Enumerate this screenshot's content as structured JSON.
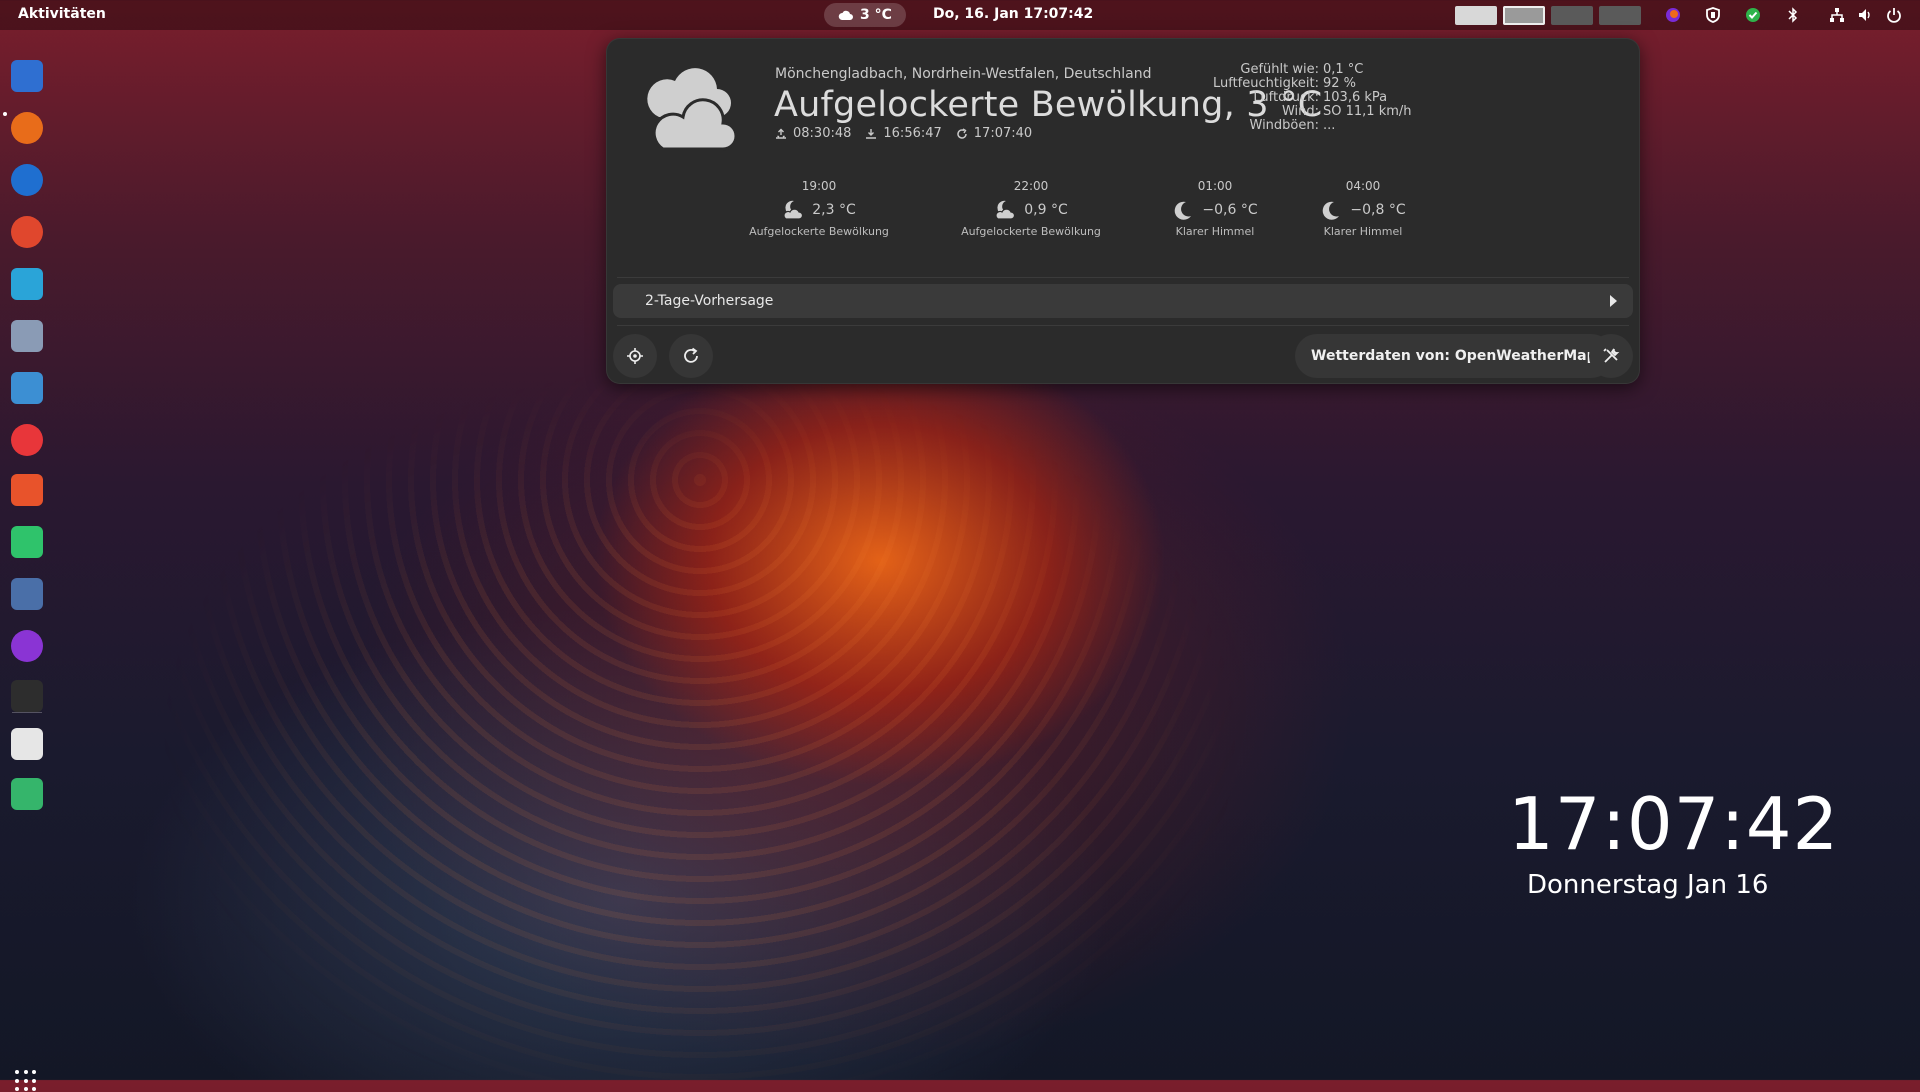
{
  "topbar": {
    "activities": "Aktivitäten",
    "weather_temp": "3 °C",
    "clock": "Do, 16. Jan  17:07:42",
    "workspaces": [
      {
        "name": "workspace-1",
        "color": "#d8d8d8"
      },
      {
        "name": "workspace-2",
        "color": "#9a9a9a"
      },
      {
        "name": "workspace-3",
        "color": "#5a5a5a"
      },
      {
        "name": "workspace-4",
        "color": "#5a5a5a"
      }
    ],
    "tray_icons": [
      "firefox-tray-icon",
      "shield-icon",
      "check-icon",
      "bluetooth-icon",
      "network-icon",
      "volume-icon",
      "power-icon"
    ]
  },
  "dock": {
    "items": [
      {
        "name": "text-editor-icon",
        "color": "#2f6fd1"
      },
      {
        "name": "firefox-icon",
        "color": "#e86c1a"
      },
      {
        "name": "thunderbird-icon",
        "color": "#1f6fd0"
      },
      {
        "name": "app-red-icon",
        "color": "#e0472d"
      },
      {
        "name": "screenshot-icon",
        "color": "#2aa4d8"
      },
      {
        "name": "software-icon",
        "color": "#8a9bb5"
      },
      {
        "name": "remote-desktop-icon",
        "color": "#3c8fd3"
      },
      {
        "name": "vivaldi-icon",
        "color": "#e8363a"
      },
      {
        "name": "downloader-icon",
        "color": "#e8532b"
      },
      {
        "name": "extensions-icon",
        "color": "#2fc36b"
      },
      {
        "name": "app-blue-icon",
        "color": "#4a6fa8"
      },
      {
        "name": "firefox-dev-icon",
        "color": "#8a34d4"
      },
      {
        "name": "terminal-icon",
        "color": "#2d2d2d"
      },
      {
        "name": "document-icon",
        "color": "#e6e6e6"
      },
      {
        "name": "trash-icon",
        "color": "#35b56b"
      }
    ]
  },
  "weather": {
    "location": "Mönchengladbach, Nordrhein-Westfalen, Deutschland",
    "summary": "Aufgelockerte Bewölkung, 3 °C",
    "sunrise": "08:30:48",
    "sunset": "16:56:47",
    "updated": "17:07:40",
    "details": [
      {
        "label": "Gefühlt wie:",
        "value": "0,1 °C"
      },
      {
        "label": "Luftfeuchtigkeit:",
        "value": "92 %"
      },
      {
        "label": "Luftdruck:",
        "value": "103,6 kPa"
      },
      {
        "label": "Wind:",
        "value": "SO 11,1 km/h"
      },
      {
        "label": "Windböen:",
        "value": "..."
      }
    ],
    "forecast": [
      {
        "time": "19:00",
        "temp": "2,3 °C",
        "condition": "Aufgelockerte Bewölkung",
        "icon": "cloudy-night-icon"
      },
      {
        "time": "22:00",
        "temp": "0,9 °C",
        "condition": "Aufgelockerte Bewölkung",
        "icon": "cloudy-night-icon"
      },
      {
        "time": "01:00",
        "temp": "−0,6 °C",
        "condition": "Klarer Himmel",
        "icon": "moon-icon"
      },
      {
        "time": "04:00",
        "temp": "−0,8 °C",
        "condition": "Klarer Himmel",
        "icon": "moon-icon"
      }
    ],
    "expander_label": "2-Tage-Vorhersage",
    "provider": "Wetterdaten von: OpenWeatherMap"
  },
  "desktop_clock": {
    "time": "17:07:42",
    "date": "Donnerstag Jan 16"
  }
}
